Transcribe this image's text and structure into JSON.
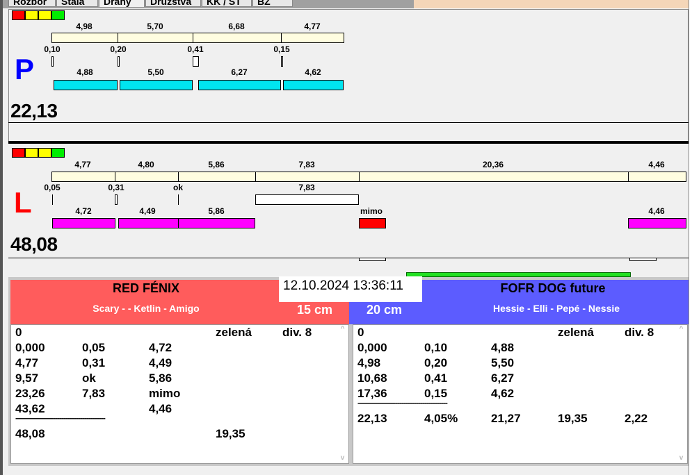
{
  "tabs": [
    "Rozbor",
    "Stala",
    "Dráhy",
    "Družstva",
    "KK / ST",
    "BZ"
  ],
  "colors": {
    "red": "#ff0000",
    "yellow": "#ffff00",
    "green": "#00e000",
    "cyan": "#00e5f0",
    "magenta": "#ff00ff",
    "team_left": "#ff5c5c",
    "team_right": "#5c5cff"
  },
  "lane_p": {
    "letter": "P",
    "total": "22,13",
    "reference": [
      "4,98",
      "5,70",
      "6,68",
      "4,77"
    ],
    "penalties": [
      "0,10",
      "0,20",
      "0,41",
      "0,15"
    ],
    "runs": [
      "4,88",
      "5,50",
      "6,27",
      "4,62"
    ]
  },
  "lane_l": {
    "letter": "L",
    "total": "48,08",
    "reference": [
      "4,77",
      "4,80",
      "5,86",
      "7,83",
      "20,36",
      "4,46"
    ],
    "penalties": [
      "0,05",
      "0,31",
      "ok",
      "7,83"
    ],
    "runs": [
      "4,72",
      "4,49",
      "5,86",
      "mimo",
      "4,46"
    ]
  },
  "datetime": "12.10.2024 13:36:11",
  "team_left": {
    "name": "RED FÉNIX",
    "dogs": "Scary -  - Ketlin - Amigo",
    "height": "15 cm",
    "header": [
      "0",
      "zelená",
      "div. 8"
    ],
    "rows": [
      [
        "0,000",
        "0,05",
        "4,72"
      ],
      [
        "4,77",
        "0,31",
        "4,49"
      ],
      [
        "9,57",
        "ok",
        "5,86"
      ],
      [
        "23,26",
        "7,83",
        "mimo"
      ],
      [
        "43,62",
        "",
        "4,46"
      ]
    ],
    "separator": "-------------------------------------------",
    "summary": [
      "48,08",
      "19,35"
    ]
  },
  "team_right": {
    "name": "FOFR DOG future",
    "dogs": "Hessie - Elli - Pepé - Nessie",
    "height": "20 cm",
    "header": [
      "0",
      "zelená",
      "div. 8"
    ],
    "rows": [
      [
        "0,000",
        "0,10",
        "4,88"
      ],
      [
        "4,98",
        "0,20",
        "5,50"
      ],
      [
        "10,68",
        "0,41",
        "6,27"
      ],
      [
        "17,36",
        "0,15",
        "4,62"
      ]
    ],
    "separator": "-------------------------------------------",
    "summary": [
      "22,13",
      "4,05%",
      "21,27",
      "19,35",
      "2,22"
    ]
  }
}
